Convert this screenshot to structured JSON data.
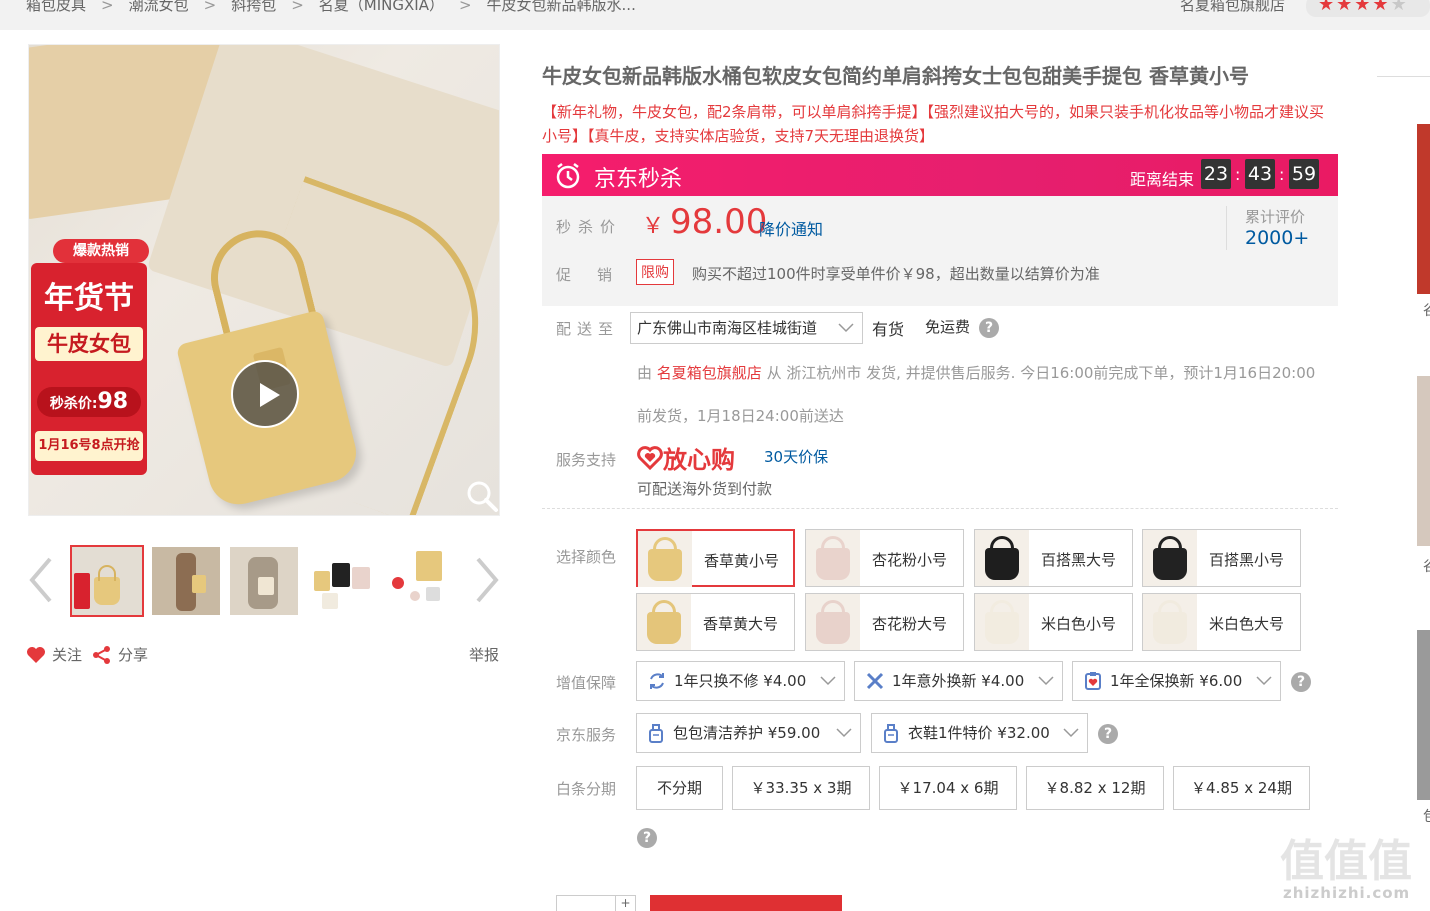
{
  "breadcrumb": {
    "items": [
      "箱包皮具",
      "潮流女包",
      "斜挎包",
      "名夏（MINGXIA）",
      "牛皮女包新品韩版水..."
    ],
    "separator": ">"
  },
  "shop": {
    "name": "名夏箱包旗舰店",
    "rating_stars": 4
  },
  "gallery": {
    "promo": {
      "hot": "爆款热销",
      "title": "年货节",
      "sub": "牛皮女包",
      "price_label": "秒杀价:",
      "price_value": "98",
      "date": "1月16号8点开抢"
    },
    "thumb_count": 5
  },
  "actions": {
    "follow": "关注",
    "share": "分享",
    "report": "举报"
  },
  "product": {
    "title": "牛皮女包新品韩版水桶包软皮女包简约单肩斜挎女士包包甜美手提包 香草黄小号",
    "subtitle": "【新年礼物，牛皮女包，配2条肩带，可以单肩斜挎手提】【强烈建议拍大号的，如果只装手机化妆品等小物品才建议买小号】【真牛皮，支持实体店验货，支持7天无理由退换货】"
  },
  "seckill": {
    "title": "京东秒杀",
    "countdown_label": "距离结束",
    "hours": "23",
    "minutes": "43",
    "seconds": "59",
    "sep": ":"
  },
  "price": {
    "label": "秒杀价",
    "currency": "￥",
    "value": "98.00",
    "notify": "降价通知",
    "review_label": "累计评价",
    "review_count": "2000+",
    "promo_label": "促销",
    "limit_badge": "限购",
    "limit_text": "购买不超过100件时享受单件价￥98，超出数量以结算价为准"
  },
  "delivery": {
    "label": "配送至",
    "address": "广东佛山市南海区桂城街道",
    "stock": "有货",
    "shipping": "免运费",
    "ship_prefix": "由",
    "ship_shop": "名夏箱包旗舰店",
    "ship_text": "从 浙江杭州市 发货, 并提供售后服务. 今日16:00前完成下单，预计1月16日20:00前发货，1月18日24:00前送达"
  },
  "service": {
    "label": "服务支持",
    "fangxin": "放心购",
    "price_protect": "30天价保",
    "overseas": "可配送海外货到付款"
  },
  "colors": {
    "label": "选择颜色",
    "options": [
      {
        "name": "香草黄小号",
        "bag": "#e6c87d",
        "selected": true
      },
      {
        "name": "杏花粉小号",
        "bag": "#e9d3cc",
        "selected": false
      },
      {
        "name": "百搭黑大号",
        "bag": "#1e1e1e",
        "selected": false
      },
      {
        "name": "百搭黑小号",
        "bag": "#222222",
        "selected": false
      },
      {
        "name": "香草黄大号",
        "bag": "#e4c57a",
        "selected": false
      },
      {
        "name": "杏花粉大号",
        "bag": "#e8d2cb",
        "selected": false
      },
      {
        "name": "米白色小号",
        "bag": "#f2ece0",
        "selected": false
      },
      {
        "name": "米白色大号",
        "bag": "#f1ebdf",
        "selected": false
      }
    ]
  },
  "warranty": {
    "label": "增值保障",
    "options": [
      "1年只换不修 ¥4.00",
      "1年意外换新 ¥4.00",
      "1年全保换新 ¥6.00"
    ]
  },
  "jd_service": {
    "label": "京东服务",
    "options": [
      "包包清洁养护 ¥59.00",
      "衣鞋1件特价 ¥32.00"
    ]
  },
  "installment": {
    "label": "白条分期",
    "options": [
      "不分期",
      "￥33.35 x 3期",
      "￥17.04 x 6期",
      "￥8.82 x 12期",
      "￥4.85 x 24期"
    ]
  },
  "quantity": {
    "plus": "+"
  },
  "sidebar": {
    "tags": [
      "谷",
      "谷",
      "包"
    ]
  },
  "watermark": {
    "text": "zhizhizhi.com",
    "logo": "值值值"
  },
  "colors_theme": {
    "accent": "#e4393c",
    "seckill": "#f51d6c",
    "link": "#005aa0"
  }
}
